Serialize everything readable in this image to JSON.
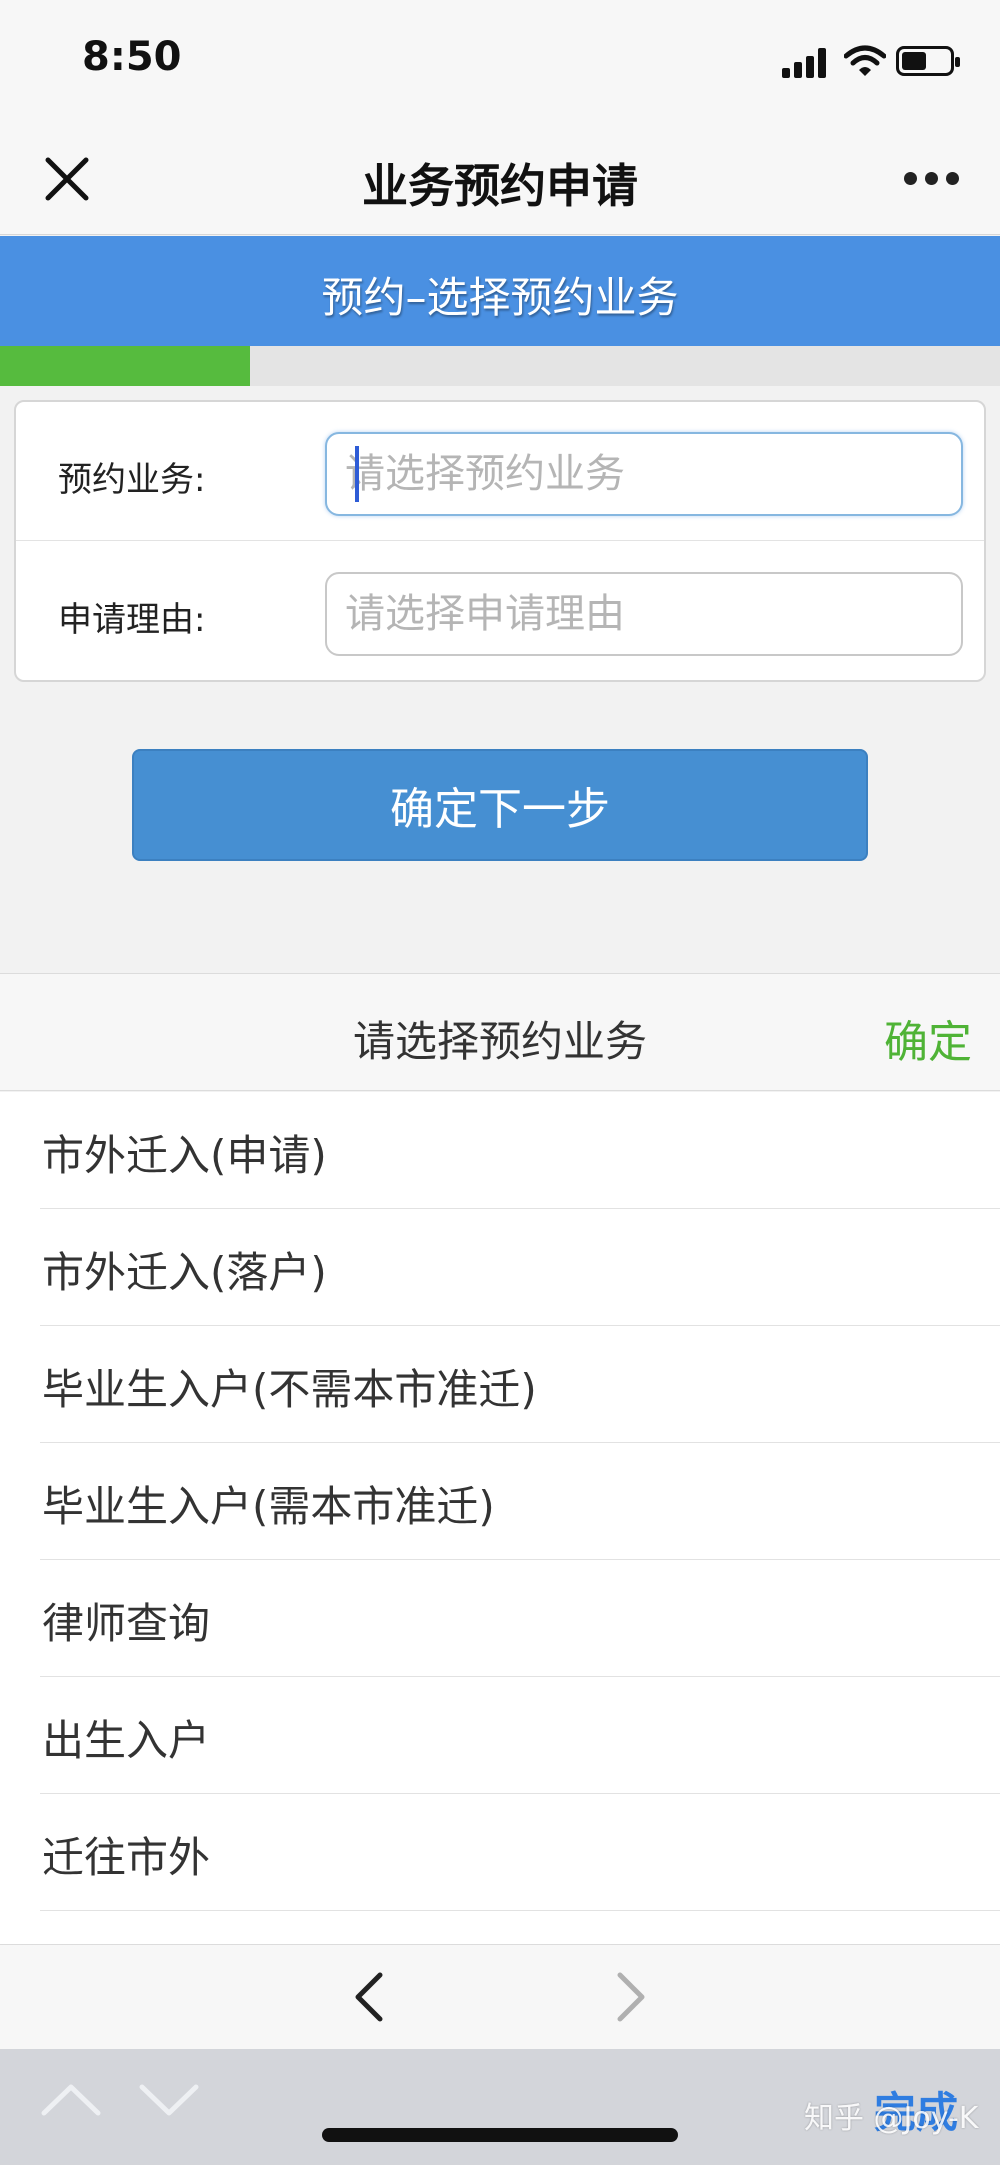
{
  "status_bar": {
    "time": "8:50"
  },
  "nav": {
    "title": "业务预约申请",
    "close_icon": "close-icon",
    "more_icon": "more-icon"
  },
  "step": {
    "title": "预约–选择预约业务",
    "progress_fraction": 0.25
  },
  "form": {
    "business_label": "预约业务:",
    "business_placeholder": "请选择预约业务",
    "reason_label": "申请理由:",
    "reason_placeholder": "请选择申请理由"
  },
  "next_button": "确定下一步",
  "picker": {
    "title": "请选择预约业务",
    "confirm": "确定",
    "items": [
      "市外迁入(申请)",
      "市外迁入(落户)",
      "毕业生入户(不需本市准迁)",
      "毕业生入户(需本市准迁)",
      "律师查询",
      "出生入户",
      "迁往市外"
    ]
  },
  "keyboard_accessory": {
    "done": "完成",
    "watermark": "知乎 @Joy-K"
  },
  "colors": {
    "header_blue": "#4a90e2",
    "progress_green": "#56bb3e",
    "confirm_green": "#4fb336",
    "done_blue": "#2f7de1"
  }
}
